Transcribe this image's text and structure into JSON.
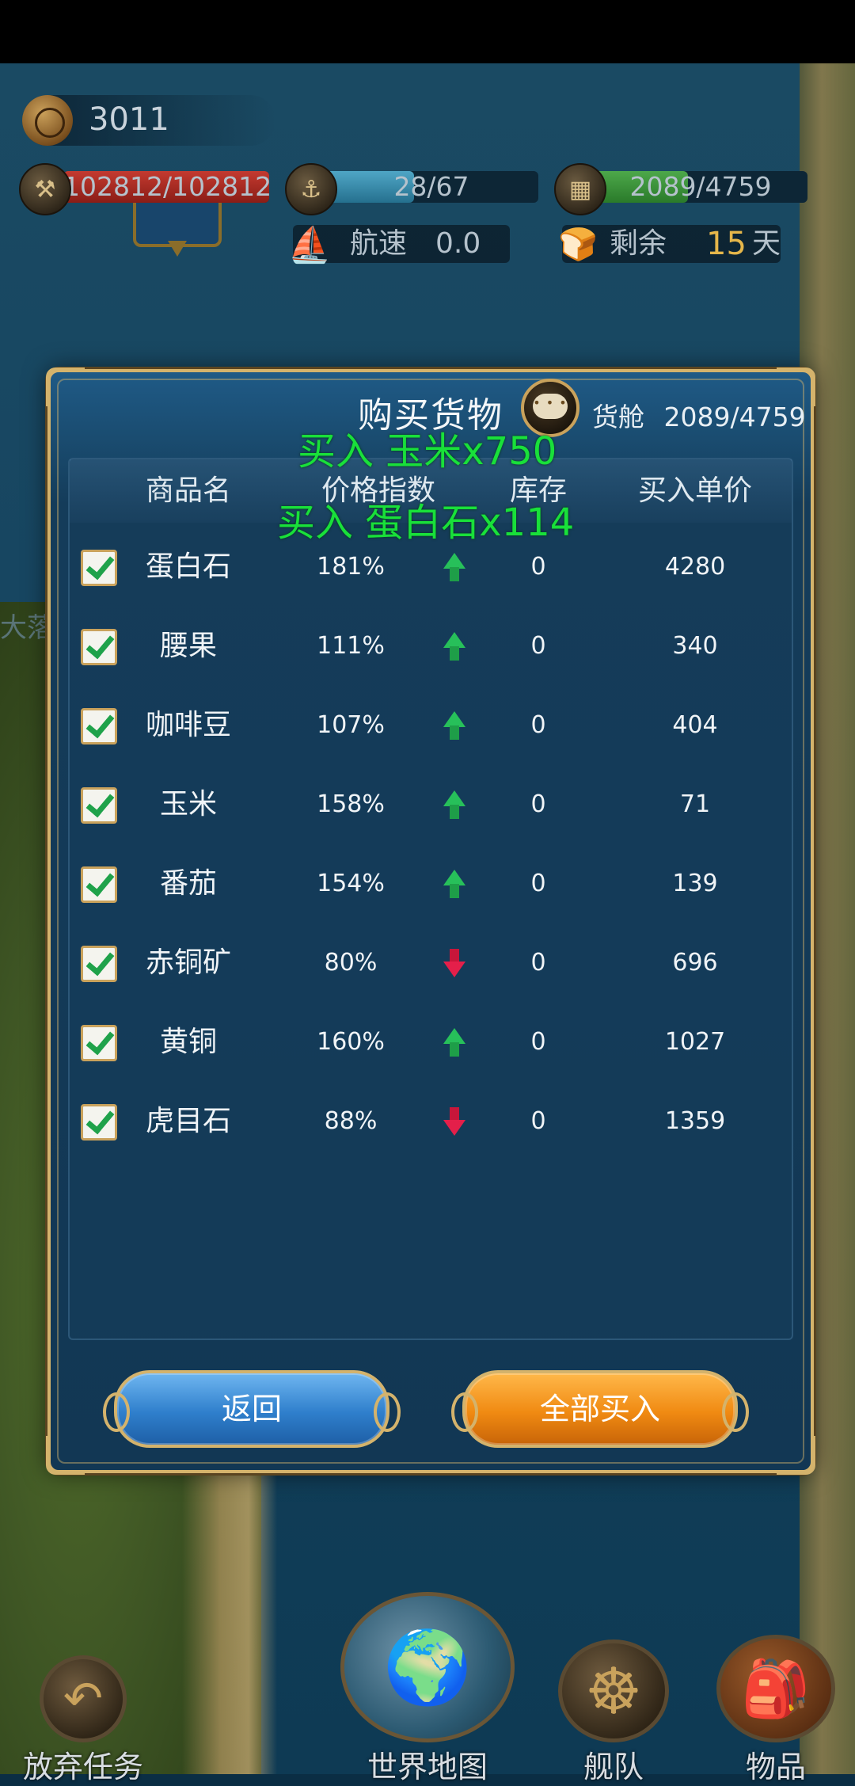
{
  "hud": {
    "gold": "3011",
    "durability": "102812/102812",
    "sailors": "28/67",
    "cargo": "2089/4759",
    "speed_label": "航速",
    "speed_value": "0.0",
    "remaining_label": "剩余",
    "remaining_value": "15",
    "remaining_unit": "天",
    "durability_fill": 1.0,
    "sailors_fill": 0.418,
    "cargo_fill": 0.439
  },
  "map": {
    "town_label": "大落"
  },
  "dialog": {
    "title": "购买货物",
    "cargo_label": "货舱",
    "cargo_value": "2089/4759",
    "columns": {
      "name": "商品名",
      "price_index": "价格指数",
      "stock": "库存",
      "unit_price": "买入单价"
    },
    "rows": [
      {
        "checked": true,
        "name": "蛋白石",
        "index": "181%",
        "trend": "up",
        "stock": "0",
        "price": "4280"
      },
      {
        "checked": true,
        "name": "腰果",
        "index": "111%",
        "trend": "up",
        "stock": "0",
        "price": "340"
      },
      {
        "checked": true,
        "name": "咖啡豆",
        "index": "107%",
        "trend": "up",
        "stock": "0",
        "price": "404"
      },
      {
        "checked": true,
        "name": "玉米",
        "index": "158%",
        "trend": "up",
        "stock": "0",
        "price": "71"
      },
      {
        "checked": true,
        "name": "番茄",
        "index": "154%",
        "trend": "up",
        "stock": "0",
        "price": "139"
      },
      {
        "checked": true,
        "name": "赤铜矿",
        "index": "80%",
        "trend": "down",
        "stock": "0",
        "price": "696"
      },
      {
        "checked": true,
        "name": "黄铜",
        "index": "160%",
        "trend": "up",
        "stock": "0",
        "price": "1027"
      },
      {
        "checked": true,
        "name": "虎目石",
        "index": "88%",
        "trend": "down",
        "stock": "0",
        "price": "1359"
      }
    ],
    "float_messages": [
      "买入  玉米x750",
      "买入  蛋白石x114"
    ],
    "back_label": "返回",
    "buy_all_label": "全部买入"
  },
  "nav": {
    "abandon": "放弃任务",
    "world_map": "世界地图",
    "fleet": "舰队",
    "items": "物品"
  },
  "colors": {
    "up_trend": "#27c05a",
    "down_trend": "#e41f4a",
    "float_text": "#19e03a",
    "frame_gold": "#d4b36c"
  }
}
